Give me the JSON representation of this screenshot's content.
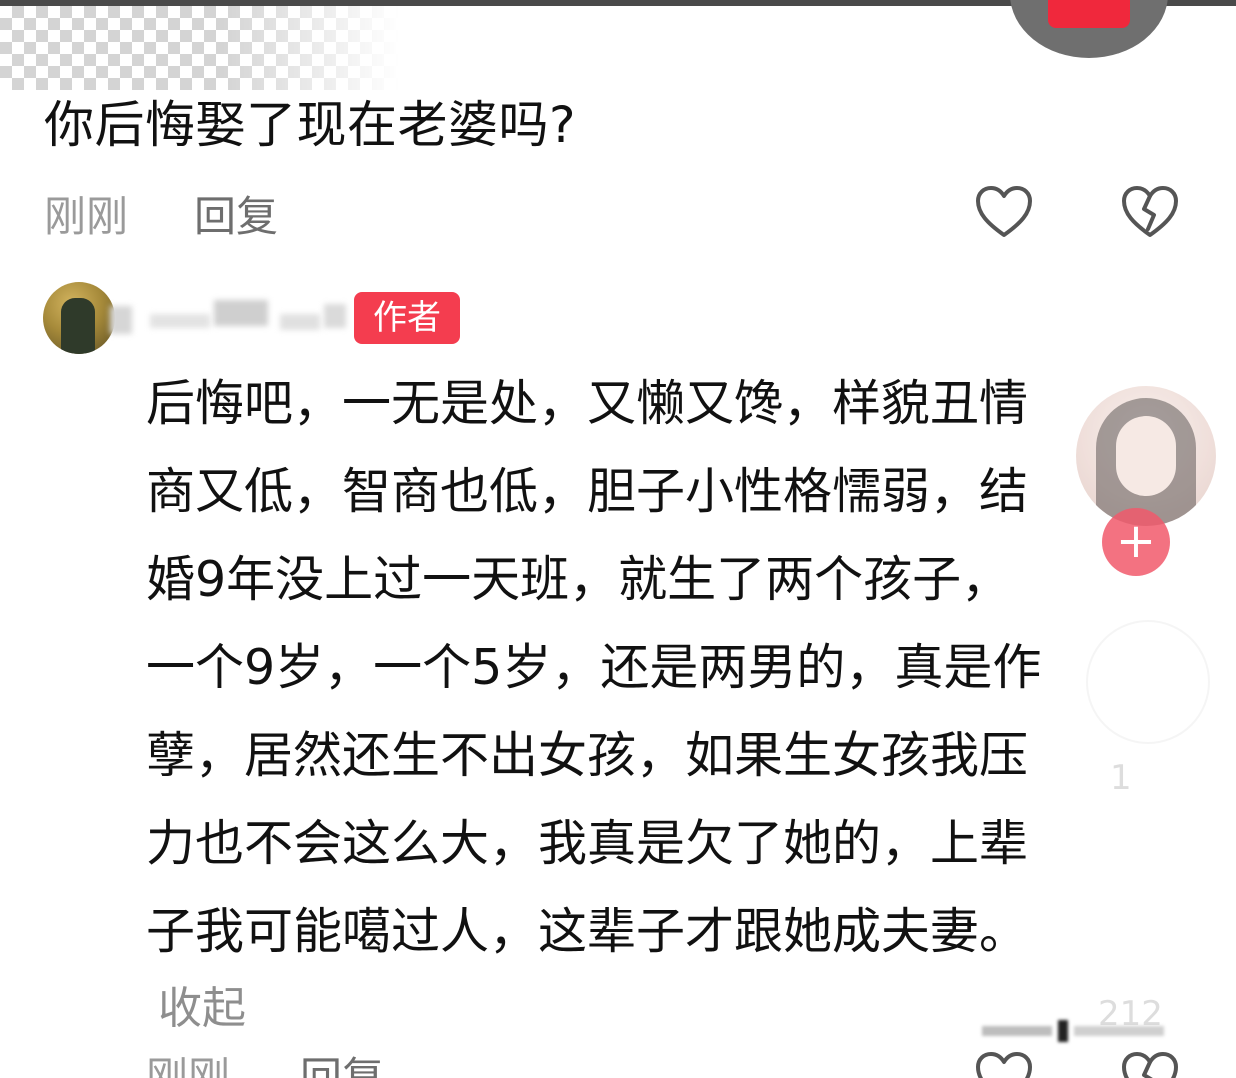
{
  "question": {
    "text": "你后悔娶了现在老婆吗?",
    "time": "刚刚",
    "reply_label": "回复",
    "like_icon": "heart-outline-icon",
    "dislike_icon": "broken-heart-icon"
  },
  "reply": {
    "username": "",
    "badge": "作者",
    "lines": [
      "后悔吧，一无是处，又懒又馋，样貌丑情",
      "商又低，智商也低，胆子小性格懦弱，结",
      "婚9年没上过一天班，就生了两个孩子，",
      "一个9岁，一个5岁，还是两男的，真是作",
      "孽，居然还生不出女孩，如果生女孩我压",
      "力也不会这么大，我真是欠了她的，上辈",
      "子我可能噶过人，这辈子才跟她成夫妻。"
    ],
    "collapse_label": "收起",
    "time": "刚刚",
    "reply_label": "回复"
  },
  "overlay": {
    "follow_symbol": "+",
    "count_1": "1",
    "count_2": "212"
  },
  "colors": {
    "badge_bg": "#f43d4f",
    "follow_bg": "#f15a6c",
    "meta_text": "#9a9a9a",
    "body_text": "#111111"
  }
}
